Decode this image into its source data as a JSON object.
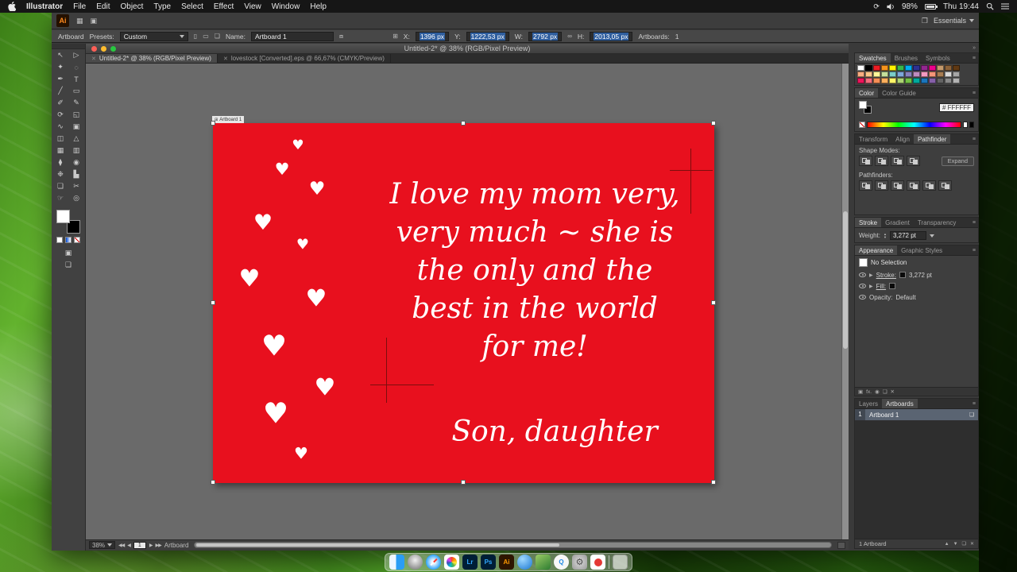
{
  "menubar": {
    "app_name": "Illustrator",
    "items": [
      "File",
      "Edit",
      "Object",
      "Type",
      "Select",
      "Effect",
      "View",
      "Window",
      "Help"
    ],
    "battery_pct": "98%",
    "clock": "Thu 19:44"
  },
  "app_bar": {
    "logo": "Ai",
    "workspace": "Essentials"
  },
  "control_bar": {
    "context": "Artboard",
    "presets_label": "Presets:",
    "presets_value": "Custom",
    "name_label": "Name:",
    "name_value": "Artboard 1",
    "x_label": "X:",
    "x_value": "1396 px",
    "y_label": "Y:",
    "y_value": "1222,53 px",
    "w_label": "W:",
    "w_value": "2792 px",
    "h_label": "H:",
    "h_value": "2013,05 px",
    "artboards_label": "Artboards:",
    "artboards_value": "1"
  },
  "document": {
    "title": "Untitled-2* @ 38% (RGB/Pixel Preview)",
    "tabs": [
      "Untitled-2* @ 38% (RGB/Pixel Preview)",
      "lovestock [Converted].eps @ 66,67% (CMYK/Preview)"
    ],
    "artboard_tag": "Artboard 1"
  },
  "card": {
    "bg_color": "#e8101e",
    "lines": [
      "I love my mom very,",
      "very much ~ she is",
      "the only and the",
      "best in the world",
      "for me!"
    ],
    "signature": "Son, daughter"
  },
  "status_bar": {
    "zoom": "38%",
    "page": "1",
    "label": "Artboard"
  },
  "panels": {
    "swatches": {
      "tabs": [
        "Swatches",
        "Brushes",
        "Symbols"
      ],
      "colors": [
        [
          "#ffffff",
          "#000000",
          "#ed1c24",
          "#f7941d",
          "#fff200",
          "#39b54a",
          "#00aeef",
          "#2e3192",
          "#92278f",
          "#ec008c",
          "#c49a6c",
          "#8c6239",
          "#603913"
        ],
        [
          "#f9ad81",
          "#fdc689",
          "#fff799",
          "#c4df9b",
          "#7accc8",
          "#7da7d9",
          "#8781bd",
          "#bd8cbf",
          "#f49ac1",
          "#f69679",
          "#a67c52",
          "#d9d9d9",
          "#a6a6a6"
        ],
        [
          "#ed145b",
          "#f26d7d",
          "#f68e56",
          "#fbaf5d",
          "#fff568",
          "#acd373",
          "#72bf44",
          "#00a99d",
          "#1b75bc",
          "#8560a8",
          "#636363",
          "#898989",
          "#b3b3b3"
        ]
      ]
    },
    "color": {
      "tabs": [
        "Color",
        "Color Guide"
      ],
      "hex_label": "#",
      "hex_value": "FFFFFF"
    },
    "pathfinder": {
      "tabs": [
        "Transform",
        "Align",
        "Pathfinder"
      ],
      "shape_modes": "Shape Modes:",
      "expand": "Expand",
      "pathfinders": "Pathfinders:"
    },
    "stroke": {
      "tabs": [
        "Stroke",
        "Gradient",
        "Transparency"
      ],
      "weight_label": "Weight:",
      "weight_value": "3,272 pt"
    },
    "appearance": {
      "tabs": [
        "Appearance",
        "Graphic Styles"
      ],
      "no_selection": "No Selection",
      "stroke_label": "Stroke:",
      "stroke_value": "3,272 pt",
      "fill_label": "Fill:",
      "opacity_label": "Opacity:",
      "opacity_value": "Default",
      "fx": "fx."
    },
    "layers": {
      "tabs": [
        "Layers",
        "Artboards"
      ],
      "row_index": "1",
      "row_name": "Artboard 1",
      "footer": "1 Artboard"
    }
  },
  "dock": {
    "apps": [
      {
        "name": "finder",
        "label": ""
      },
      {
        "name": "launchpad",
        "label": ""
      },
      {
        "name": "safari",
        "label": ""
      },
      {
        "name": "photos",
        "label": ""
      },
      {
        "name": "lightroom",
        "label": "Lr"
      },
      {
        "name": "photoshop",
        "label": "Ps"
      },
      {
        "name": "illustrator",
        "label": "Ai"
      },
      {
        "name": "app-store",
        "label": ""
      },
      {
        "name": "green-app",
        "label": ""
      },
      {
        "name": "quicktime",
        "label": "Q"
      },
      {
        "name": "system-preferences",
        "label": ""
      },
      {
        "name": "media-app",
        "label": ""
      },
      {
        "name": "trash",
        "label": ""
      }
    ]
  }
}
